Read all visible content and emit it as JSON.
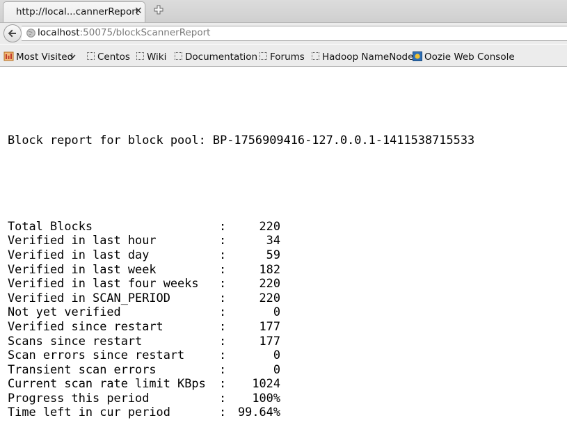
{
  "tab": {
    "title": "http://local...cannerReport",
    "close": "✕"
  },
  "urlbar": {
    "host": "localhost",
    "path": ":50075/blockScannerReport"
  },
  "bookmarks": [
    {
      "label": "Most Visited",
      "icon": "most-visited-icon"
    },
    {
      "label": "Centos",
      "icon": "bookmark-icon"
    },
    {
      "label": "Wiki",
      "icon": "bookmark-icon"
    },
    {
      "label": "Documentation",
      "icon": "bookmark-icon"
    },
    {
      "label": "Forums",
      "icon": "bookmark-icon"
    },
    {
      "label": "Hadoop NameNode",
      "icon": "bookmark-icon"
    },
    {
      "label": "Oozie Web Console",
      "icon": "oozie-icon"
    }
  ],
  "report": {
    "heading": "Block report for block pool: BP-1756909416-127.0.0.1-1411538715533",
    "rows": [
      {
        "label": "Total Blocks",
        "value": "220"
      },
      {
        "label": "Verified in last hour",
        "value": "34"
      },
      {
        "label": "Verified in last day",
        "value": "59"
      },
      {
        "label": "Verified in last week",
        "value": "182"
      },
      {
        "label": "Verified in last four weeks",
        "value": "220"
      },
      {
        "label": "Verified in SCAN_PERIOD",
        "value": "220"
      },
      {
        "label": "Not yet verified",
        "value": "0"
      },
      {
        "label": "Verified since restart",
        "value": "177"
      },
      {
        "label": "Scans since restart",
        "value": "177"
      },
      {
        "label": "Scan errors since restart",
        "value": "0"
      },
      {
        "label": "Transient scan errors",
        "value": "0"
      },
      {
        "label": "Current scan rate limit KBps",
        "value": "1024"
      },
      {
        "label": "Progress this period",
        "value": "100%"
      },
      {
        "label": "Time left in cur period",
        "value": "99.64%"
      }
    ],
    "separator": ":"
  }
}
